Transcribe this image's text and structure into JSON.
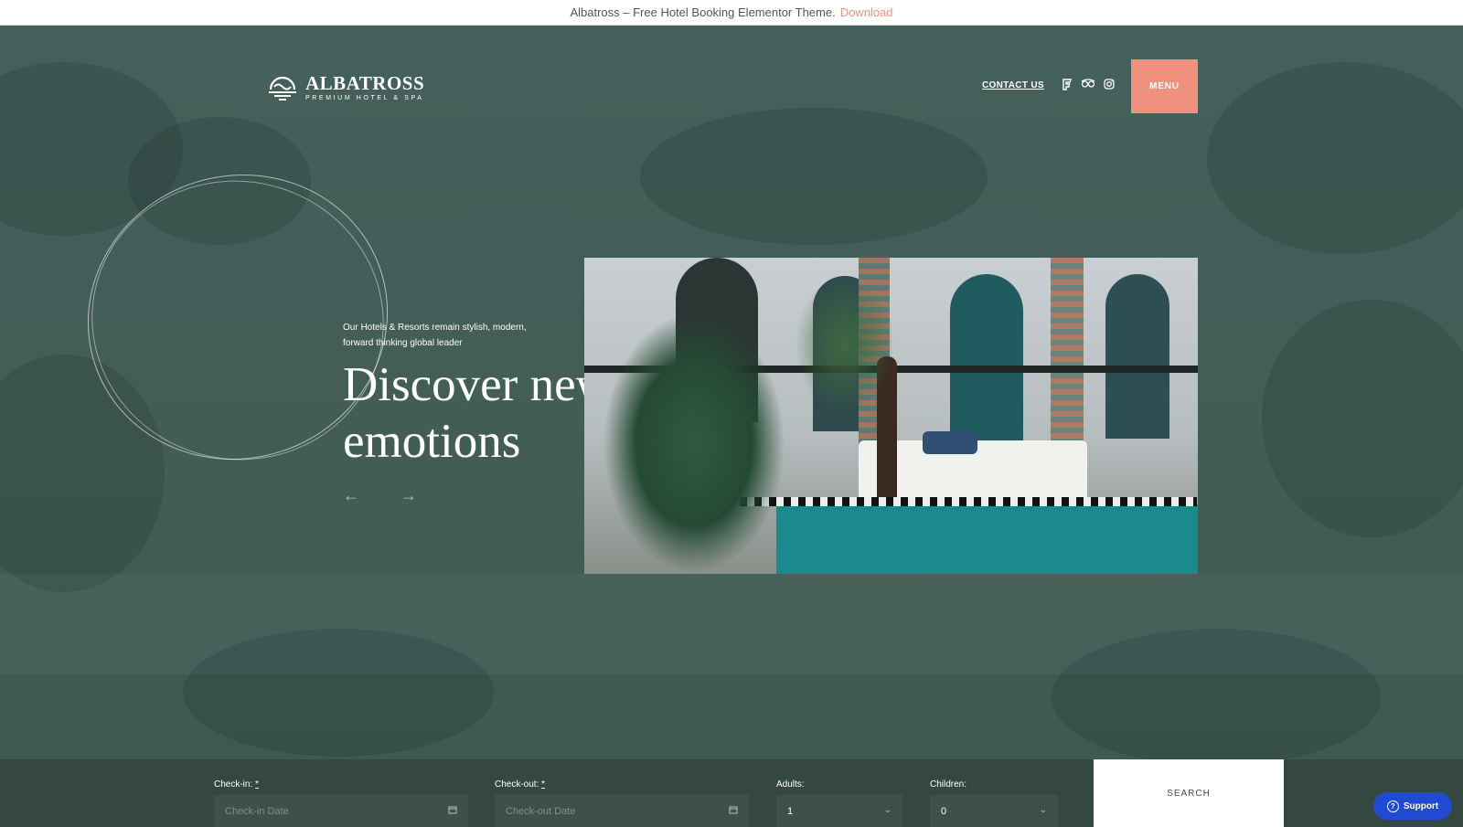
{
  "promo": {
    "text": "Albatross – Free Hotel Booking Elementor Theme.",
    "link": "Download"
  },
  "header": {
    "logo": {
      "name": "ALBATROSS",
      "tagline": "PREMIUM HOTEL & SPA"
    },
    "contact_label": "CONTACT US",
    "social_icons": [
      "foursquare-icon",
      "tripadvisor-icon",
      "instagram-icon"
    ],
    "menu_label": "MENU"
  },
  "hero": {
    "intro": "Our Hotels & Resorts remain stylish, modern, forward thinking global leader",
    "headline": "Discover new emotions",
    "prev_arrow": "←",
    "next_arrow": "→"
  },
  "booking": {
    "checkin": {
      "label": "Check-in:",
      "required": "*",
      "placeholder": "Check-in Date"
    },
    "checkout": {
      "label": "Check-out:",
      "required": "*",
      "placeholder": "Check-out Date"
    },
    "adults": {
      "label": "Adults:",
      "value": "1"
    },
    "children": {
      "label": "Children:",
      "value": "0"
    },
    "search_label": "SEARCH"
  },
  "support_label": "Support",
  "colors": {
    "accent": "#f0917f",
    "hero_bg": "#425d56",
    "booking_bg": "#35483f",
    "support_bg": "#1f4ad1"
  }
}
